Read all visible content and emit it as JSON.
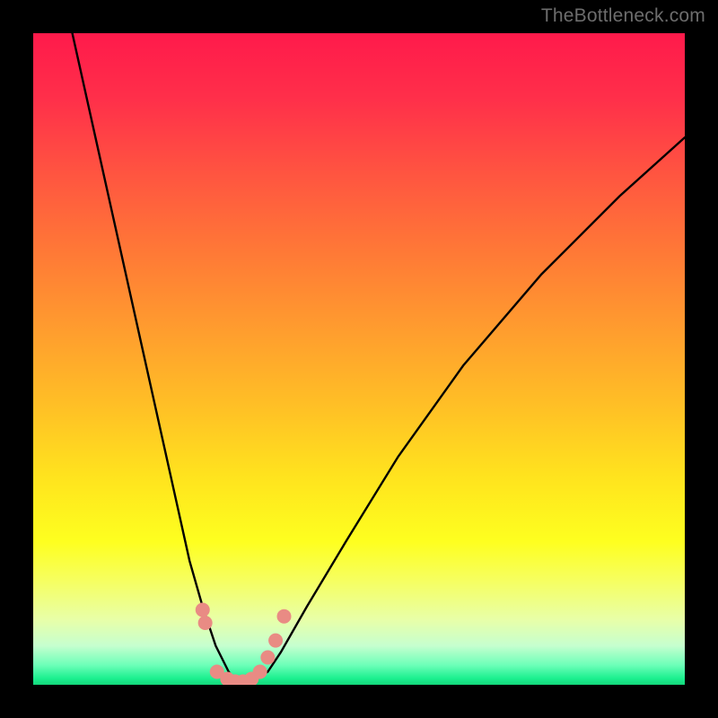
{
  "watermark": "TheBottleneck.com",
  "chart_data": {
    "type": "line",
    "title": "",
    "xlabel": "",
    "ylabel": "",
    "xlim": [
      0,
      100
    ],
    "ylim": [
      0,
      100
    ],
    "grid": false,
    "legend": false,
    "series": [
      {
        "name": "bottleneck-curve",
        "color": "#000000",
        "x": [
          6,
          10,
          14,
          18,
          22,
          24,
          26,
          28,
          30,
          31,
          32,
          33,
          34,
          36,
          38,
          42,
          48,
          56,
          66,
          78,
          90,
          100
        ],
        "values": [
          100,
          82,
          64,
          46,
          28,
          19,
          12,
          6,
          2,
          0.8,
          0.3,
          0.3,
          0.8,
          2,
          5,
          12,
          22,
          35,
          49,
          63,
          75,
          84
        ]
      }
    ],
    "markers": {
      "name": "highlight-points",
      "color": "#e98b84",
      "radius_px": 8,
      "points": [
        {
          "x": 26.0,
          "y": 11.5
        },
        {
          "x": 26.4,
          "y": 9.5
        },
        {
          "x": 28.2,
          "y": 2.0
        },
        {
          "x": 29.8,
          "y": 0.9
        },
        {
          "x": 31.0,
          "y": 0.5
        },
        {
          "x": 32.2,
          "y": 0.5
        },
        {
          "x": 33.5,
          "y": 0.9
        },
        {
          "x": 34.8,
          "y": 2.0
        },
        {
          "x": 36.0,
          "y": 4.2
        },
        {
          "x": 37.2,
          "y": 6.8
        },
        {
          "x": 38.5,
          "y": 10.5
        }
      ]
    }
  }
}
